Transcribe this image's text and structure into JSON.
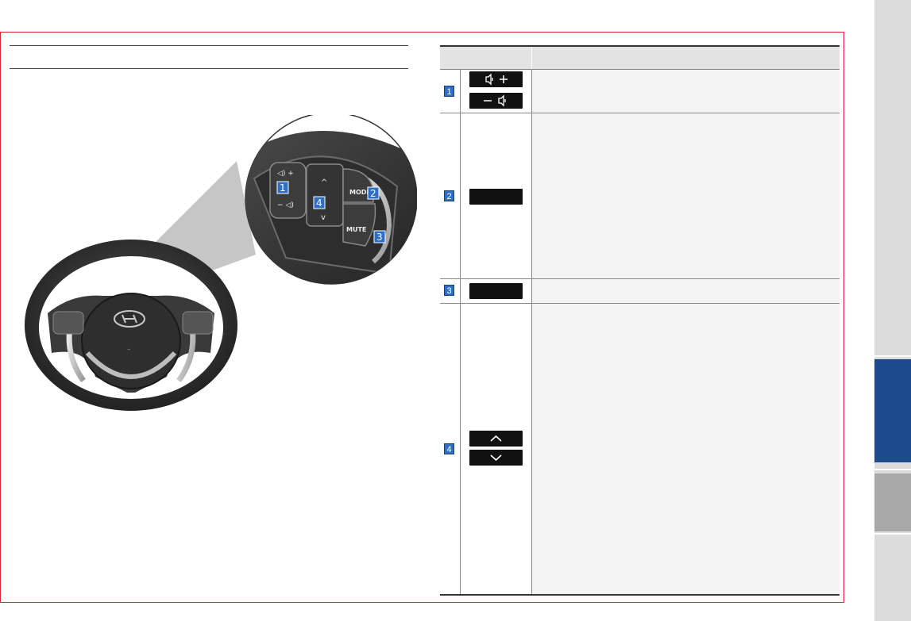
{
  "figure": {
    "callouts": [
      "1",
      "2",
      "3",
      "4"
    ],
    "button_labels": {
      "mode": "MODE",
      "mute": "MUTE"
    },
    "horn_symbol": "⌁"
  },
  "table": {
    "rows": [
      {
        "num": "1",
        "controls": [
          "volume-up-icon",
          "volume-down-icon"
        ]
      },
      {
        "num": "2",
        "controls": [
          "mode-button"
        ]
      },
      {
        "num": "3",
        "controls": [
          "mute-button"
        ]
      },
      {
        "num": "4",
        "controls": [
          "chevron-up-icon",
          "chevron-down-icon"
        ]
      }
    ]
  },
  "colors": {
    "frame": "#d92430",
    "accent_tab": "#1c4b8c",
    "badge": "#2f6fc3"
  }
}
